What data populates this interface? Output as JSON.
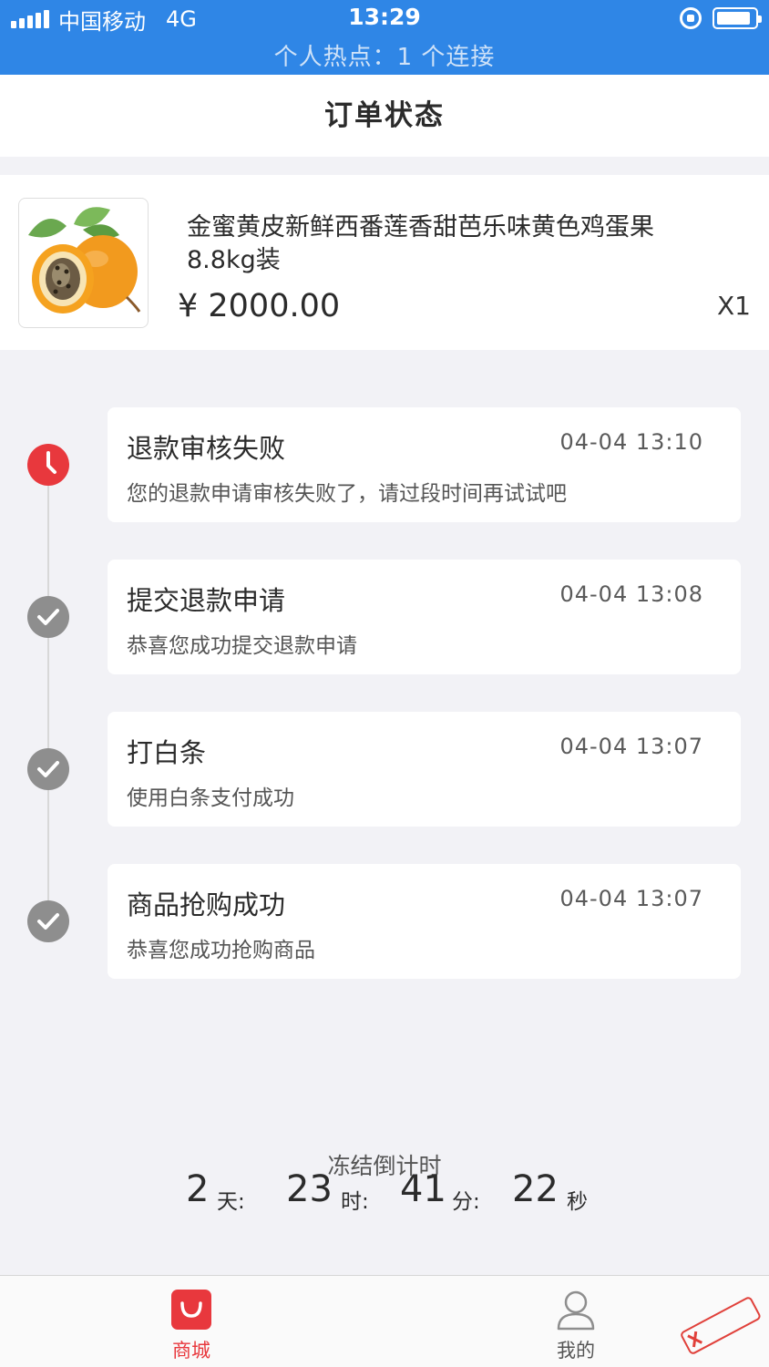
{
  "status_bar": {
    "carrier": "中国移动",
    "network": "4G",
    "time": "13:29",
    "hotspot": "个人热点：1 个连接",
    "battery_level": 0.9
  },
  "header": {
    "title": "订单状态"
  },
  "product": {
    "name": "金蜜黄皮新鲜西番莲香甜芭乐味黄色鸡蛋果8.8kg装",
    "price": "¥ 2000.00",
    "qty": "X1",
    "image_icon": "passion-fruit-image"
  },
  "timeline": [
    {
      "title": "退款审核失败",
      "time": "04-04 13:10",
      "desc": "您的退款申请审核失败了，请过段时间再试试吧",
      "status": "failed",
      "icon": "clock-icon"
    },
    {
      "title": "提交退款申请",
      "time": "04-04 13:08",
      "desc": "恭喜您成功提交退款申请",
      "status": "done",
      "icon": "check-icon"
    },
    {
      "title": "打白条",
      "time": "04-04 13:07",
      "desc": "使用白条支付成功",
      "status": "done",
      "icon": "check-icon"
    },
    {
      "title": "商品抢购成功",
      "time": "04-04 13:07",
      "desc": "恭喜您成功抢购商品",
      "status": "done",
      "icon": "check-icon"
    }
  ],
  "countdown": {
    "label": "冻结倒计时",
    "days": "2",
    "days_unit": "天:",
    "hours": "23",
    "hours_unit": "时:",
    "minutes": "41",
    "minutes_unit": "分:",
    "seconds": "22",
    "seconds_unit": "秒"
  },
  "tab_bar": {
    "shop_label": "商城",
    "mine_label": "我的",
    "active": "shop"
  },
  "colors": {
    "status_bar": "#2f86e6",
    "accent_red": "#e8383d",
    "node_gray": "#8e8e8e",
    "background": "#f2f2f6"
  }
}
